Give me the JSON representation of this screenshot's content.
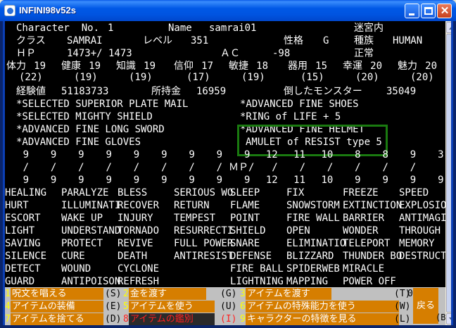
{
  "window": {
    "title": "INFINI98v52s"
  },
  "char": {
    "character_label": "Character  No.",
    "character_no": "1",
    "name_label": "Name",
    "name": "samrai01",
    "location": "迷宮内",
    "class_label": "クラス",
    "class": "SAMRAI",
    "level_label": "レベル",
    "level": "351",
    "alignment_label": "性格",
    "alignment": "G",
    "race_label": "種族",
    "race": "HUMAN",
    "hp_label": "ＨＰ",
    "hp": "1473+/ 1473",
    "ac_label": "ＡＣ",
    "ac": "-98",
    "status": "正常",
    "stats": [
      {
        "label": "体力",
        "value": "19",
        "base": "(22)"
      },
      {
        "label": "健康",
        "value": "19",
        "base": "(19)"
      },
      {
        "label": "知識",
        "value": "19",
        "base": "(19)"
      },
      {
        "label": "信仰",
        "value": "17",
        "base": "(17)"
      },
      {
        "label": "敏捷",
        "value": "18",
        "base": "(19)"
      },
      {
        "label": "器用",
        "value": "15",
        "base": "(15)"
      },
      {
        "label": "幸運",
        "value": "20",
        "base": "(20)"
      },
      {
        "label": "魅力",
        "value": "20",
        "base": "(20)"
      }
    ],
    "exp_label": "経験値",
    "exp": "51183733",
    "gold_label": "所持金",
    "gold": "16959",
    "kills_label": "倒したモンスター",
    "kills": "35049"
  },
  "equipment": [
    "*SELECTED SUPERIOR PLATE MAIL",
    "*SELECTED MIGHTY SHIELD",
    "*ADVANCED FINE LONG SWORD",
    "*ADVANCED FINE GLOVES",
    "*ADVANCED FINE SHOES",
    "*RING of LIFE + 5",
    "*ADVANCED FINE HELMET",
    "AMULET of RESIST type 5"
  ],
  "spell_points": {
    "row1": [
      "9",
      "9",
      "9",
      "9",
      "9",
      "9",
      "9",
      "9",
      "9",
      "12",
      "11",
      "10",
      "8",
      "8",
      "9",
      "3",
      "9"
    ],
    "row2": [
      "/",
      "/",
      "/",
      "/",
      "/",
      "/",
      "/",
      "/",
      "/",
      "/",
      "/",
      "/",
      "/",
      "/"
    ],
    "mp_label": "ＭＰ/",
    "row3": [
      "9",
      "9",
      "9",
      "9",
      "9",
      "9",
      "9",
      "9",
      "9",
      "12",
      "11",
      "10",
      "9",
      "9",
      "9",
      "9",
      "9"
    ]
  },
  "spells": [
    [
      "HEALING",
      "PARALYZE",
      "BLESS",
      "SERIOUS WO",
      "SLEEP",
      "FIX",
      "FREEZE",
      "SPEED"
    ],
    [
      "HURT",
      "ILLUMINATI",
      "RECOVER",
      "RETURN",
      "FLAME",
      "SNOWSTORM",
      "EXTINCTION",
      "EXPLOSION"
    ],
    [
      "ESCORT",
      "WAKE UP",
      "INJURY",
      "TEMPEST",
      "POINT",
      "FIRE WALL",
      "BARRIER",
      "ANTIMAGIC"
    ],
    [
      "LIGHT",
      "UNDERSTAND",
      "TORNADO",
      "RESURRECTI",
      "SHIELD",
      "OPEN",
      "WONDER",
      "THROUGH WA"
    ],
    [
      "SAVING",
      "PROTECT",
      "REVIVE",
      "FULL POWER",
      "SNARE",
      "ELIMINATIO",
      "TELEPORT",
      "MEMORY"
    ],
    [
      "SILENCE",
      "CURE",
      "DEATH",
      "ANTIRESIST",
      "DEFENSE",
      "BLIZZARD",
      "THUNDER BO",
      "DESTRUCTIO"
    ],
    [
      "DETECT",
      "WOUND",
      "CYCLONE",
      "",
      "FIRE BALL",
      "SPIDERWEB",
      "MIRACLE",
      ""
    ],
    [
      "GUARD",
      "ANTIPOISON",
      "REFRESH",
      "",
      "LIGHTNING",
      "MAPPING",
      "POWER OFF",
      ""
    ]
  ],
  "menu": [
    {
      "num": "1",
      "label": "呪文を唱える",
      "key": "(S)"
    },
    {
      "num": "2",
      "label": "金を渡す",
      "key": "(G)"
    },
    {
      "num": "3",
      "label": "アイテムを渡す",
      "key": "(T)"
    },
    {
      "num": "4",
      "label": "アイテムの装備",
      "key": "(E)"
    },
    {
      "num": "5",
      "label": "アイテムを使う",
      "key": "(U)"
    },
    {
      "num": "6",
      "label": "アイテムの特殊能力を使う",
      "key": "(W)"
    },
    {
      "num": "7",
      "label": "アイテムを捨てる",
      "key": "(D)"
    },
    {
      "num": "8",
      "label": "アイテムの鑑別",
      "key": "(I)"
    },
    {
      "num": "9",
      "label": "キャラクターの特徴を見る",
      "key": "(L)"
    }
  ],
  "menu_extra": {
    "zero": "0",
    "back_label": "戻る",
    "back_key": "(B)"
  },
  "colors": {
    "highlight_box": "#1a7a10",
    "menu_button": "#d67e00",
    "menu_number": "#ffff00",
    "menu_selected": "#ff2020"
  }
}
